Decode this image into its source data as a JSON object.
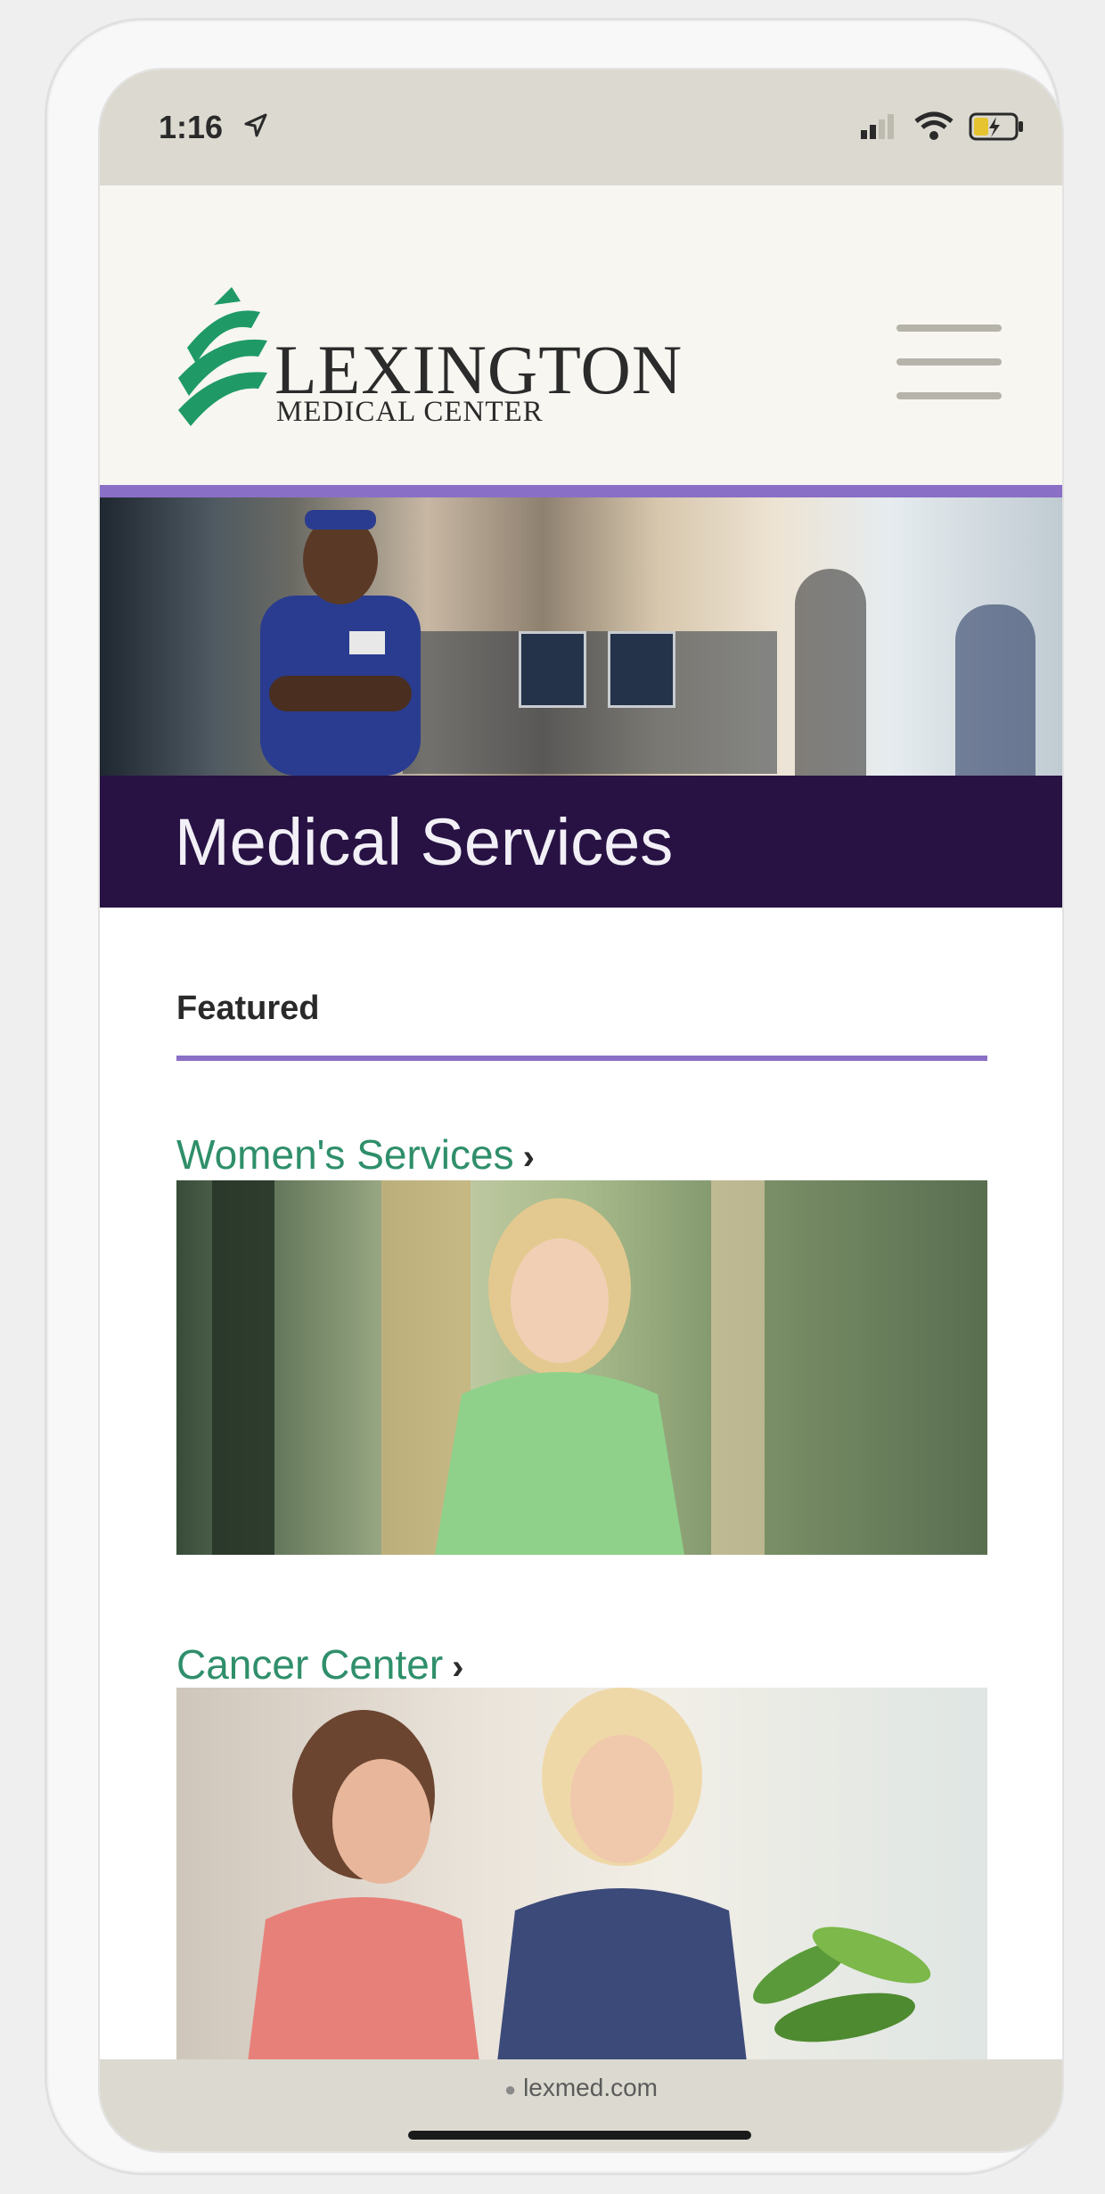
{
  "status_bar": {
    "time": "1:16"
  },
  "header": {
    "logo_main": "LEXINGTON",
    "logo_sub": "MEDICAL CENTER"
  },
  "hero": {
    "title": "Medical Services"
  },
  "featured": {
    "label": "Featured",
    "items": [
      {
        "label": "Women's Services",
        "chevron": "›"
      },
      {
        "label": "Cancer Center",
        "chevron": "›"
      }
    ]
  },
  "browser": {
    "url": "lexmed.com"
  },
  "colors": {
    "accent_purple": "#8a6fc6",
    "title_band": "#281244",
    "link_green": "#2f8f6a",
    "logo_green": "#1f9a66"
  },
  "icons": [
    "location-arrow-icon",
    "signal-icon",
    "wifi-icon",
    "battery-charging-icon",
    "menu-icon",
    "lock-icon"
  ]
}
